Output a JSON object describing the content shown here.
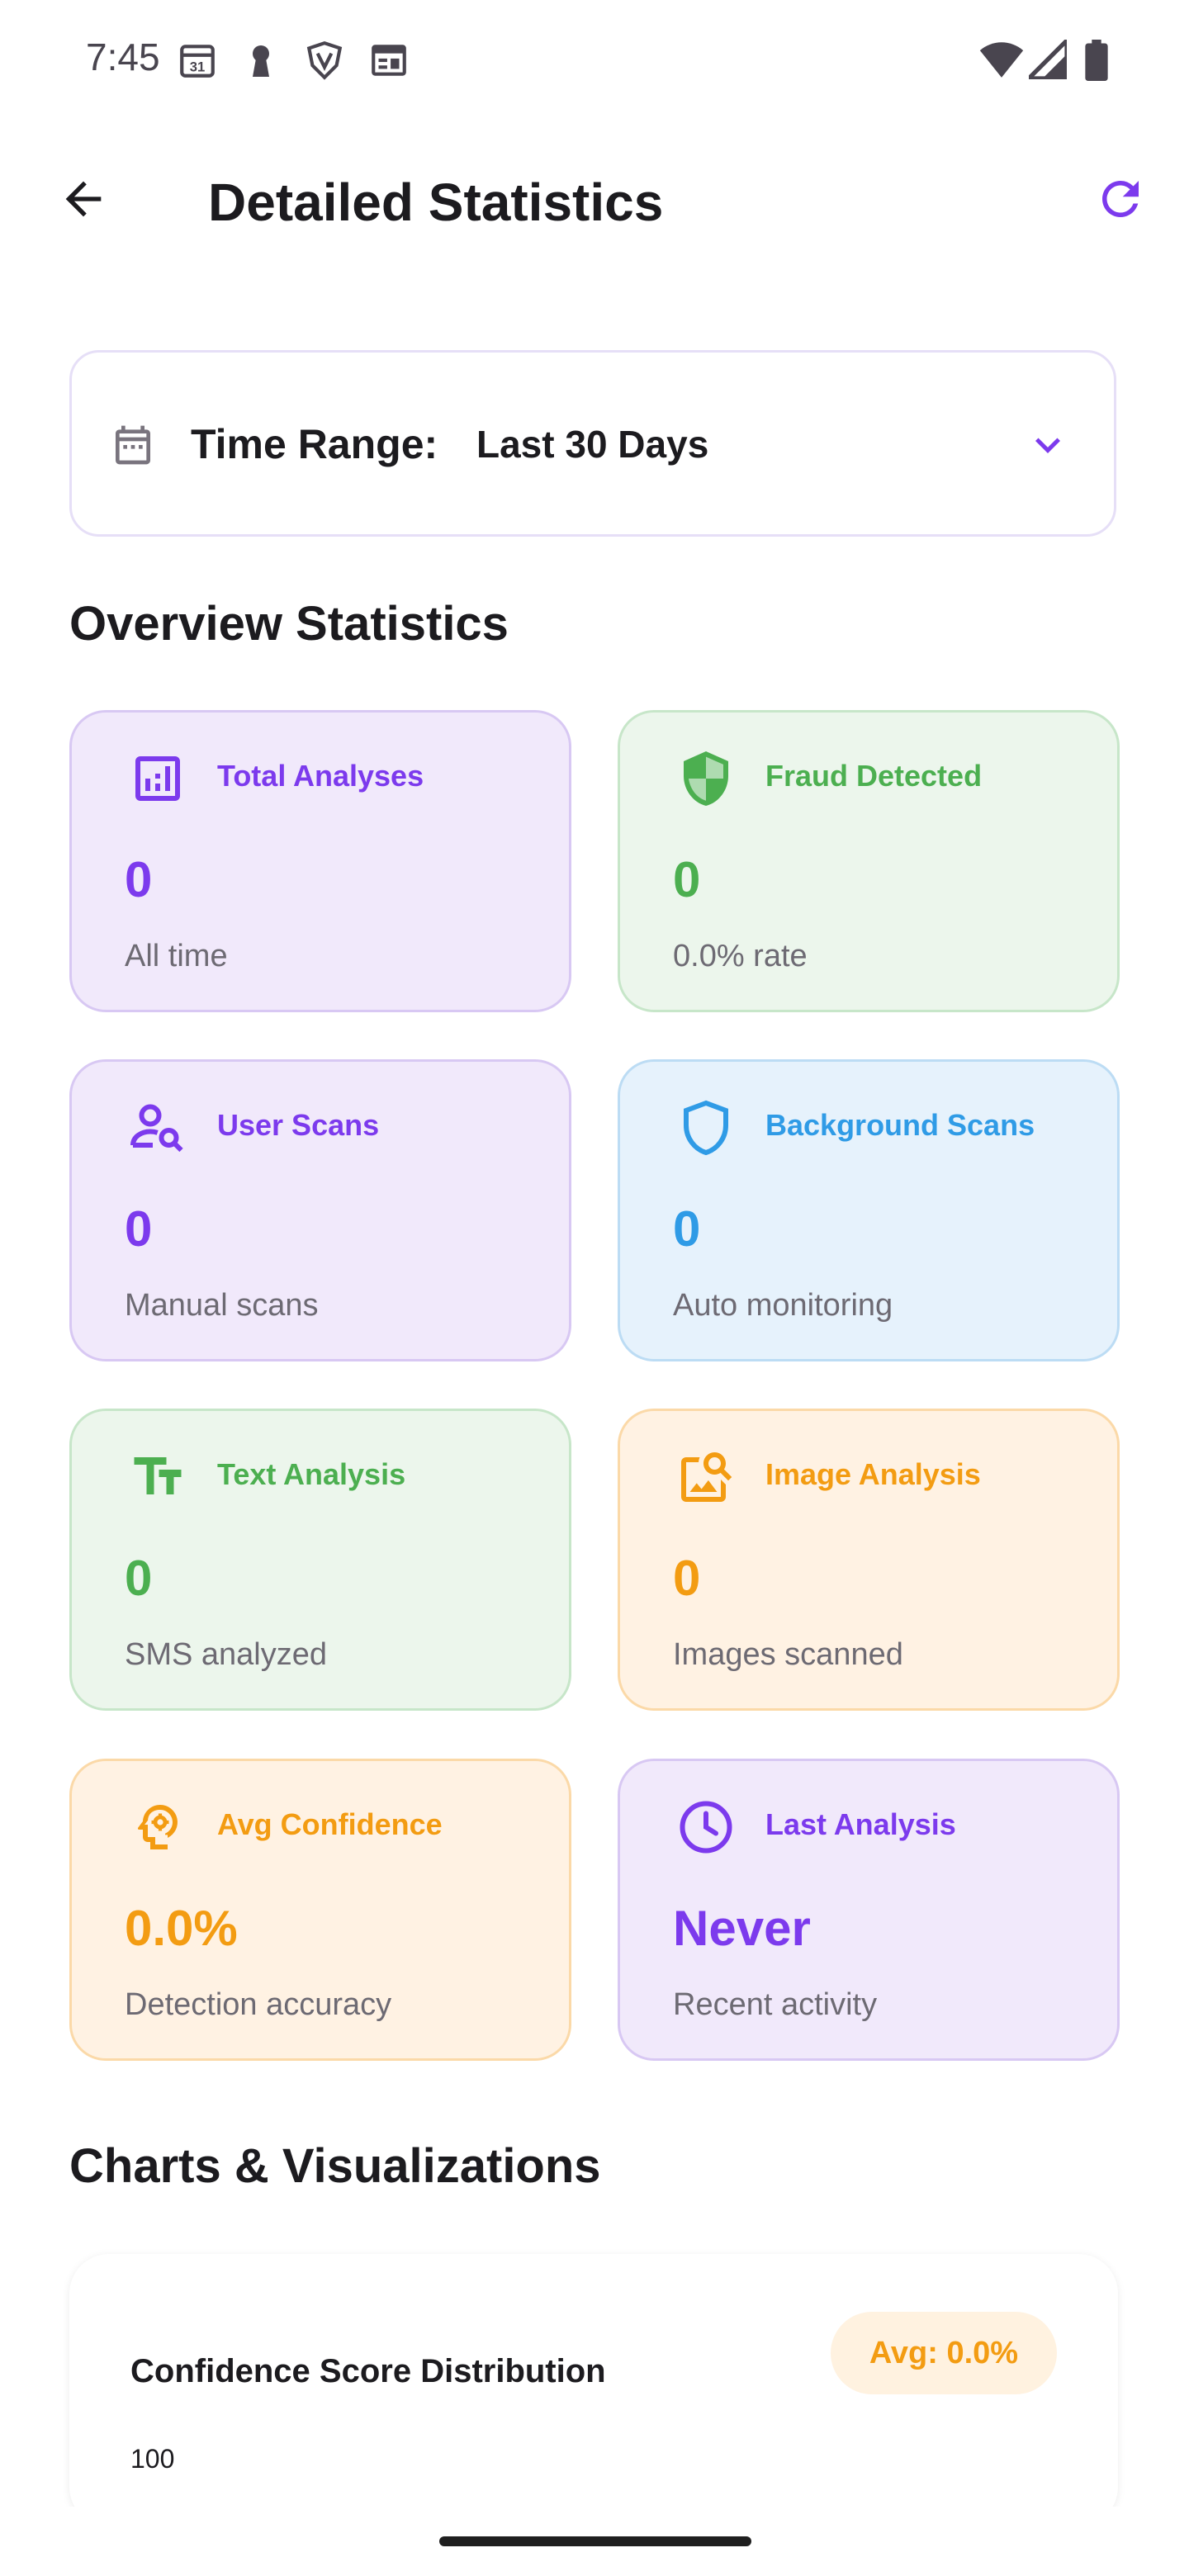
{
  "status_bar": {
    "time": "7:45",
    "icons": [
      "calendar-31-icon",
      "keyhole-icon",
      "shield-v-icon",
      "news-icon",
      "wifi-icon",
      "signal-icon",
      "battery-icon"
    ]
  },
  "app_bar": {
    "back_icon": "arrow-back-icon",
    "title": "Detailed Statistics",
    "refresh_icon": "refresh-icon"
  },
  "time_range": {
    "label": "Time Range:",
    "value": "Last 30 Days",
    "icon": "calendar-icon",
    "dropdown_icon": "chevron-down-icon"
  },
  "overview": {
    "title": "Overview Statistics",
    "cards": [
      {
        "label": "Total Analyses",
        "value": "0",
        "sub": "All time",
        "icon": "bar-chart-icon",
        "color": "#7c3aed",
        "bg": "#f1e9fb",
        "border": "#d8c8f3"
      },
      {
        "label": "Fraud Detected",
        "value": "0",
        "sub": "0.0% rate",
        "icon": "shield-check-icon",
        "color": "#4caf50",
        "bg": "#ecf6ec",
        "border": "#c7e6c9"
      },
      {
        "label": "User Scans",
        "value": "0",
        "sub": "Manual scans",
        "icon": "user-search-icon",
        "color": "#7c3aed",
        "bg": "#f1e9fb",
        "border": "#d8c8f3"
      },
      {
        "label": "Background Scans",
        "value": "0",
        "sub": "Auto monitoring",
        "icon": "shield-icon",
        "color": "#2f9be6",
        "bg": "#e6f2fc",
        "border": "#bcdcf4"
      },
      {
        "label": "Text Analysis",
        "value": "0",
        "sub": "SMS analyzed",
        "icon": "text-fields-icon",
        "color": "#4caf50",
        "bg": "#ecf6ec",
        "border": "#c7e6c9"
      },
      {
        "label": "Image Analysis",
        "value": "0",
        "sub": "Images scanned",
        "icon": "image-search-icon",
        "color": "#f39c12",
        "bg": "#fff2e3",
        "border": "#fbd9a8"
      },
      {
        "label": "Avg Confidence",
        "value": "0.0%",
        "sub": "Detection accuracy",
        "icon": "psychology-icon",
        "color": "#f39c12",
        "bg": "#fff2e3",
        "border": "#fbd9a8"
      },
      {
        "label": "Last Analysis",
        "value": "Never",
        "sub": "Recent activity",
        "icon": "clock-icon",
        "color": "#7c3aed",
        "bg": "#f1e9fb",
        "border": "#d8c8f3"
      }
    ]
  },
  "charts": {
    "title": "Charts & Visualizations",
    "confidence_card": {
      "title": "Confidence Score Distribution",
      "badge": "Avg: 0.0%",
      "y_tick": "100"
    }
  },
  "colors": {
    "accent": "#7c3aed",
    "green": "#4caf50",
    "blue": "#2f9be6",
    "orange": "#f39c12"
  }
}
